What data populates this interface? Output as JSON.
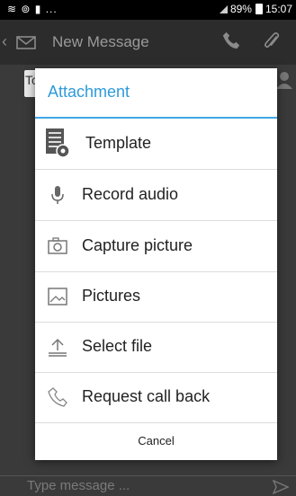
{
  "status_bar": {
    "left": "≋ ⊚ ▮ ...",
    "battery": "89%",
    "time": "15:07"
  },
  "app": {
    "title": "New Message",
    "to_field": "To",
    "compose_placeholder": "Type message ..."
  },
  "dialog": {
    "title": "Attachment",
    "items": [
      {
        "label": "Template",
        "icon": "template-icon"
      },
      {
        "label": "Record audio",
        "icon": "microphone-icon"
      },
      {
        "label": "Capture picture",
        "icon": "camera-icon"
      },
      {
        "label": "Pictures",
        "icon": "picture-icon"
      },
      {
        "label": "Select file",
        "icon": "upload-icon"
      },
      {
        "label": "Request call back",
        "icon": "phone-icon"
      }
    ],
    "cancel_label": "Cancel"
  },
  "colors": {
    "accent": "#2f9ad9",
    "divider": "#40a8e6",
    "overlay": "#3a3a3a"
  }
}
